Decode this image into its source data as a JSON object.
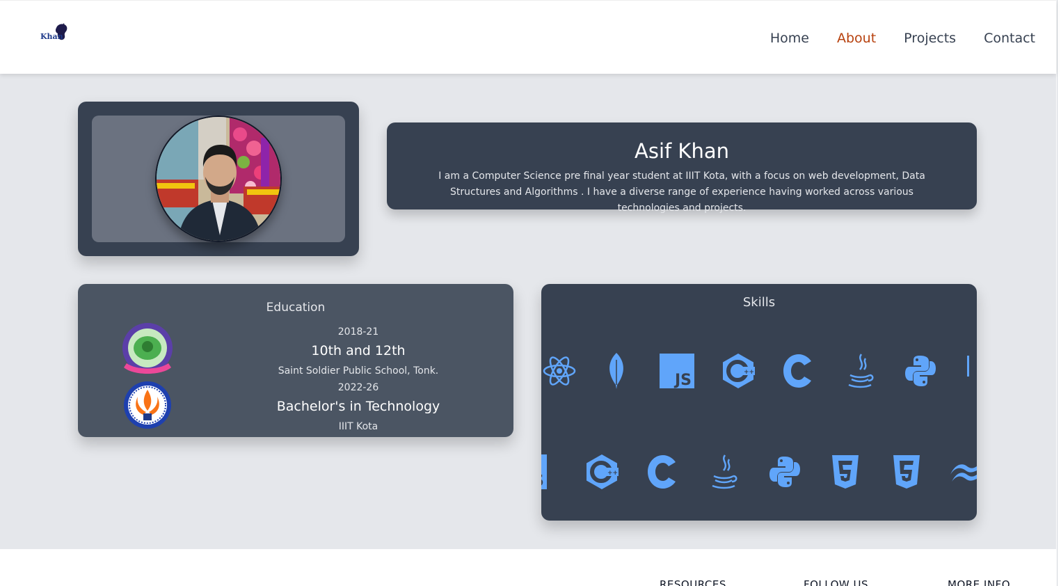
{
  "header": {
    "logo_text": "Khan",
    "nav": [
      {
        "label": "Home",
        "active": false
      },
      {
        "label": "About",
        "active": true
      },
      {
        "label": "Projects",
        "active": false
      },
      {
        "label": "Contact",
        "active": false
      }
    ]
  },
  "intro": {
    "name": "Asif Khan",
    "bio": "I am a Computer Science pre final year student at IIIT Kota, with a focus on web development, Data Structures and Algorithms . I have a diverse range of experience having worked across various technologies and projects."
  },
  "education": {
    "title": "Education",
    "entries": [
      {
        "year": "2018-21",
        "degree": "10th and 12th",
        "school": "Saint Soldier Public School, Tonk."
      },
      {
        "year": "2022-26",
        "degree": "Bachelor's in Technology",
        "school": "IIIT Kota"
      }
    ]
  },
  "skills": {
    "title": "Skills",
    "row1": [
      "react-icon",
      "mongodb-icon",
      "javascript-icon",
      "cplusplus-icon",
      "c-icon",
      "java-icon",
      "python-icon"
    ],
    "row2": [
      "javascript-icon",
      "cplusplus-icon",
      "c-icon",
      "java-icon",
      "python-icon",
      "html5-icon",
      "css3-icon",
      "tailwind-icon"
    ]
  },
  "footer": {
    "columns": [
      "RESOURCES",
      "FOLLOW US",
      "MORE INFO"
    ]
  },
  "colors": {
    "accent": "#b7410e",
    "card_dark": "#374151",
    "card_mid": "#4b5563",
    "icon_blue": "#60a5fa",
    "page_bg": "#e5e7eb"
  }
}
